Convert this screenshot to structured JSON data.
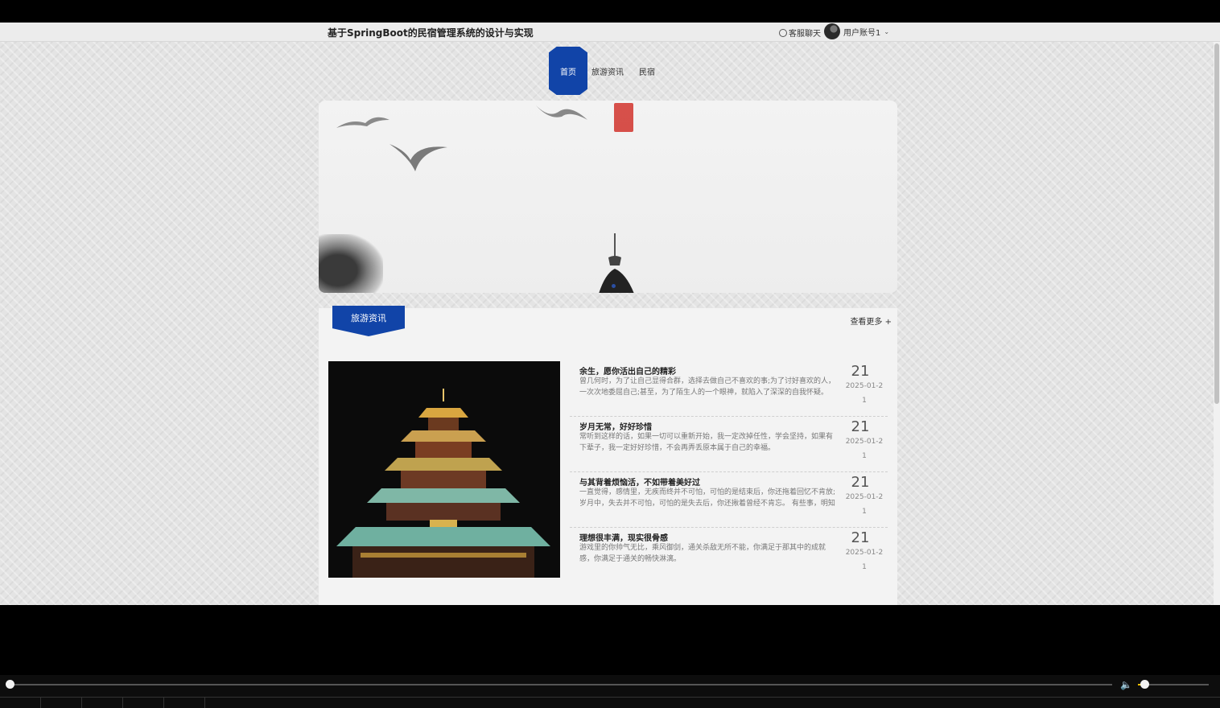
{
  "header": {
    "site_title": "基于SpringBoot的民宿管理系统的设计与实现",
    "service_chat": "客服聊天",
    "user_account": "用户账号1"
  },
  "nav": {
    "items": [
      {
        "label": "首页",
        "active": true
      },
      {
        "label": "旅游资讯",
        "active": false
      },
      {
        "label": "民宿",
        "active": false
      }
    ]
  },
  "section": {
    "title": "旅游资讯",
    "see_more": "查看更多 +"
  },
  "news": [
    {
      "title": "余生，愿你活出自己的精彩",
      "summary": "曾几何时，为了让自己显得合群，选择去做自己不喜欢的事;为了讨好喜欢的人，一次次地委屈自己;甚至，为了陌生人的一个眼神，就陷入了深深的自我怀疑。",
      "day": "21",
      "date": "2025-01-21"
    },
    {
      "title": "岁月无常，好好珍惜",
      "summary": "常听到这样的话，如果一切可以重新开始，我一定改掉任性，学会坚持，如果有下辈子，我一定好好珍惜，不会再弄丢原本属于自己的幸福。",
      "day": "21",
      "date": "2025-01-21"
    },
    {
      "title": "与其背着烦恼活，不如带着美好过",
      "summary": "一直觉得，感情里，无疾而终并不可怕，可怕的是结束后，你还拖着回忆不肯放;岁月中，失去并不可怕，可怕的是失去后，你还揪着曾经不肯忘。 有些事，明知",
      "day": "21",
      "date": "2025-01-21"
    },
    {
      "title": "理想很丰满，现实很骨感",
      "summary": "游戏里的你帅气无比，乘风御剑，通关杀敌无所不能，你满足于那其中的成就感，你满足于通关的畅快淋漓。",
      "day": "21",
      "date": "2025-01-21"
    }
  ],
  "player": {
    "progress": 0.0,
    "volume": 0.08,
    "accent_color": "#f0c000"
  },
  "colors": {
    "brand_blue": "#1144a8",
    "seal_red": "#d1322b"
  },
  "icons": {
    "chat": "headset-icon",
    "user_menu": "chevron-down-icon",
    "volume": "speaker-icon"
  }
}
